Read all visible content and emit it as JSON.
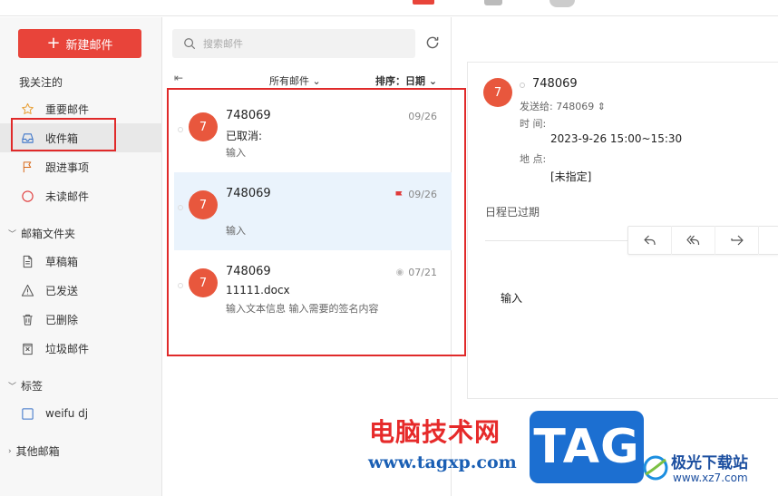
{
  "sidebar": {
    "compose_label": "新建邮件",
    "favorites_title": "我关注的",
    "favorites": [
      {
        "label": "重要邮件",
        "icon": "star-icon"
      },
      {
        "label": "收件箱",
        "icon": "inbox-icon"
      },
      {
        "label": "跟进事项",
        "icon": "flag-icon"
      },
      {
        "label": "未读邮件",
        "icon": "circle-icon"
      }
    ],
    "folders_title": "邮箱文件夹",
    "folders": [
      {
        "label": "草稿箱",
        "icon": "draft-icon"
      },
      {
        "label": "已发送",
        "icon": "sent-icon"
      },
      {
        "label": "已删除",
        "icon": "trash-icon"
      },
      {
        "label": "垃圾邮件",
        "icon": "spam-icon"
      }
    ],
    "tags_title": "标签",
    "tags": [
      {
        "label": "weifu dj"
      }
    ],
    "other_title": "其他邮箱"
  },
  "list": {
    "search_placeholder": "搜索邮件",
    "filter_label": "所有邮件",
    "sort_label": "排序：日期",
    "mails": [
      {
        "avatar": "7",
        "sender": "748069",
        "date": "09/26",
        "subject": "已取消:",
        "preview": "输入",
        "flag": false,
        "viewed": false
      },
      {
        "avatar": "7",
        "sender": "748069",
        "date": "09/26",
        "subject": "",
        "preview": "输入",
        "flag": true,
        "viewed": false
      },
      {
        "avatar": "7",
        "sender": "748069",
        "date": "07/21",
        "subject": "11111.docx",
        "preview": "输入文本信息 输入需要的签名内容",
        "flag": false,
        "viewed": true
      }
    ]
  },
  "detail": {
    "avatar": "7",
    "sender": "748069",
    "to_label": "发送给: 748069",
    "time_label": "时 间:",
    "time_value": "2023-9-26 15:00~15:30",
    "place_label": "地 点:",
    "place_value": "[未指定]",
    "expired": "日程已过期",
    "body": "输入"
  },
  "watermark": {
    "site_cn": "电脑技术网",
    "site_url": "www.tagxp.com",
    "tag": "TAG",
    "jg_name": "极光下载站",
    "jg_url": "www.xz7.com"
  },
  "colors": {
    "accent": "#e8443a",
    "avatar": "#e8573d",
    "selected_row": "#eaf3fc",
    "highlight_box": "#e02a2a"
  }
}
